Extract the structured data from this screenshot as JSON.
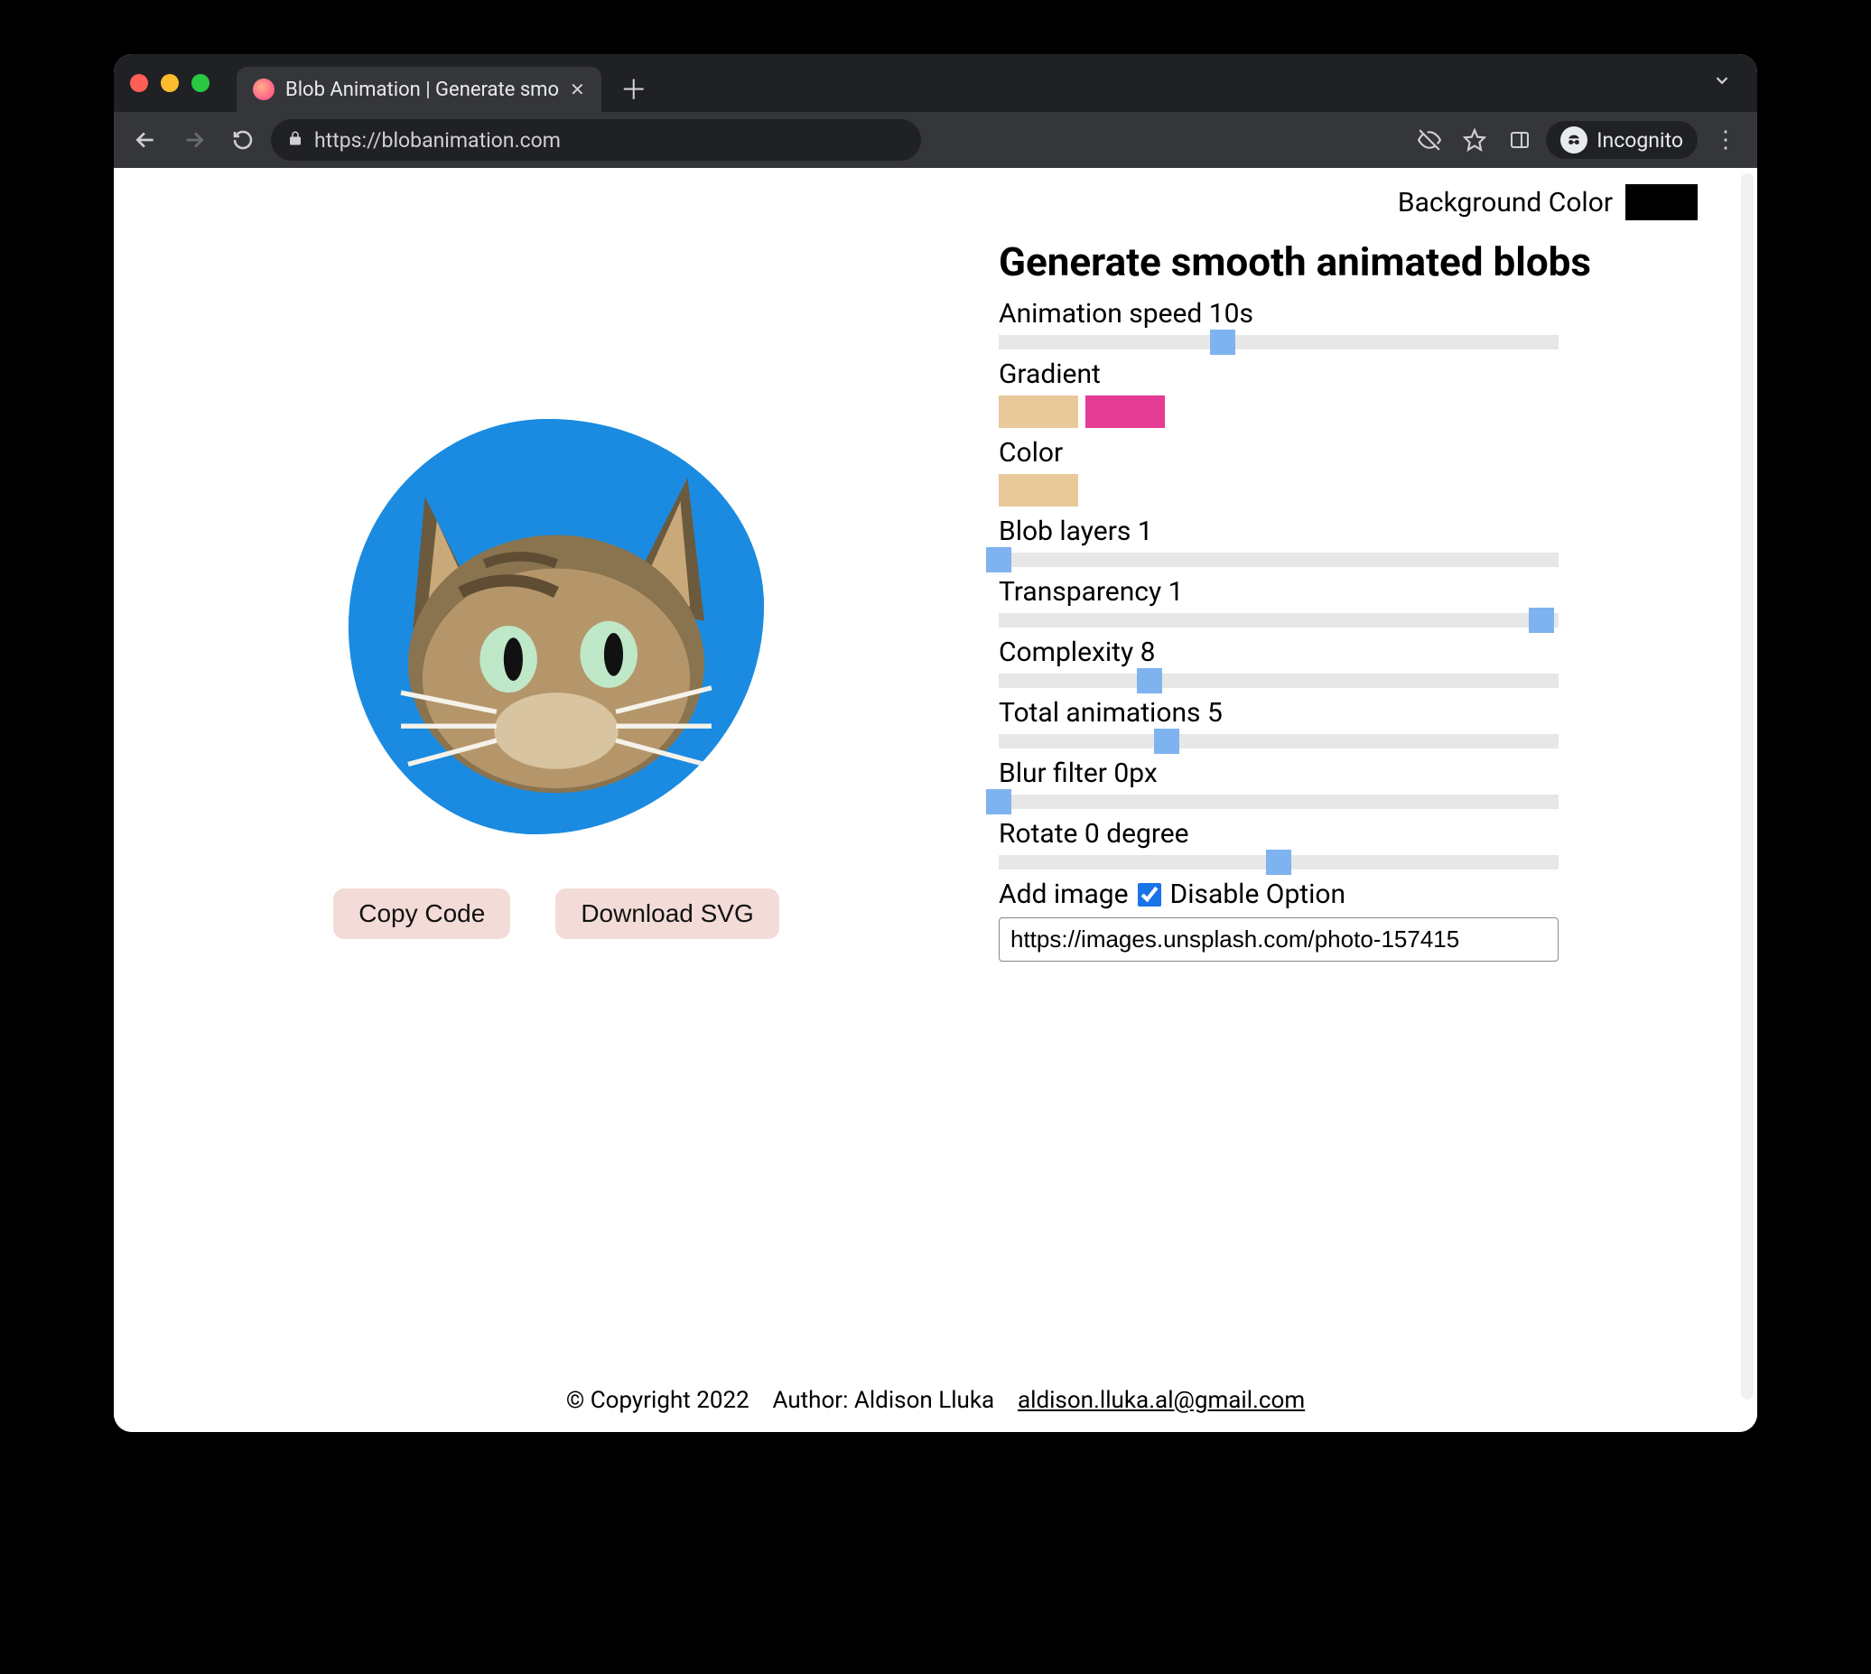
{
  "browser": {
    "tab_title": "Blob Animation | Generate smo",
    "url": "https://blobanimation.com",
    "incognito_label": "Incognito"
  },
  "header": {
    "bg_label": "Background Color",
    "bg_color": "#000000"
  },
  "title": "Generate smooth animated blobs",
  "buttons": {
    "copy": "Copy Code",
    "download": "Download SVG"
  },
  "controls": {
    "speed": {
      "label": "Animation speed 10s",
      "value": 10,
      "min": 1,
      "max": 30,
      "pos_pct": 40
    },
    "gradient": {
      "label": "Gradient",
      "colors": [
        "#e9c99a",
        "#e53b94"
      ]
    },
    "color": {
      "label": "Color",
      "value": "#e9c99a"
    },
    "layers": {
      "label": "Blob layers 1",
      "value": 1,
      "min": 1,
      "max": 10,
      "pos_pct": 0
    },
    "transparency": {
      "label": "Transparency 1",
      "value": 1,
      "min": 0,
      "max": 1,
      "pos_pct": 97
    },
    "complexity": {
      "label": "Complexity 8",
      "value": 8,
      "min": 1,
      "max": 30,
      "pos_pct": 27
    },
    "total_anim": {
      "label": "Total animations 5",
      "value": 5,
      "min": 1,
      "max": 20,
      "pos_pct": 30
    },
    "blur": {
      "label": "Blur filter 0px",
      "value": 0,
      "min": 0,
      "max": 50,
      "pos_pct": 0
    },
    "rotate": {
      "label": "Rotate 0 degree",
      "value": 0,
      "min": -180,
      "max": 180,
      "pos_pct": 50
    },
    "add_image": {
      "label": "Add image",
      "disable_label": "Disable Option",
      "checked": true,
      "url": "https://images.unsplash.com/photo-157415"
    }
  },
  "footer": {
    "copyright": "© Copyright 2022",
    "author_prefix": "Author: ",
    "author_name": "Aldison Lluka",
    "email": "aldison.lluka.al@gmail.com"
  }
}
